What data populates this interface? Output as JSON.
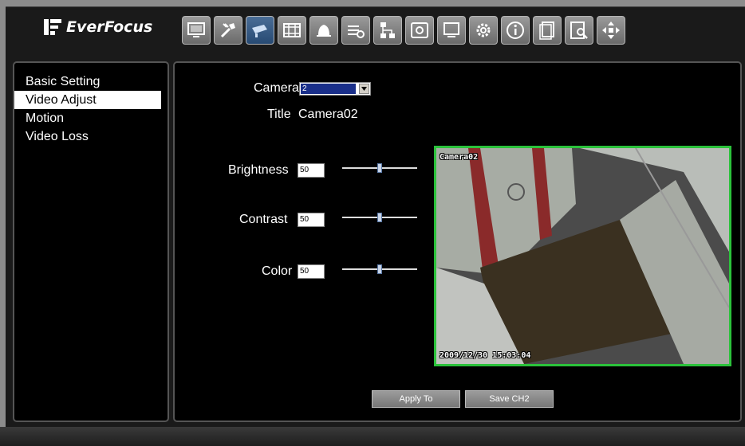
{
  "brand": {
    "name": "EverFocus",
    "logo_icon": "ef-logo-icon"
  },
  "toolbar": {
    "buttons": [
      {
        "icon": "monitor-icon"
      },
      {
        "icon": "tools-icon"
      },
      {
        "icon": "camera-icon",
        "active": true
      },
      {
        "icon": "film-icon"
      },
      {
        "icon": "alarm-bell-icon"
      },
      {
        "icon": "schedule-icon"
      },
      {
        "icon": "network-icon"
      },
      {
        "icon": "backup-disk-icon"
      },
      {
        "icon": "display-icon"
      },
      {
        "icon": "gear-icon"
      },
      {
        "icon": "info-icon"
      },
      {
        "icon": "log-icon"
      },
      {
        "icon": "search-icon"
      },
      {
        "icon": "ptz-icon"
      }
    ]
  },
  "sidebar": {
    "items": [
      {
        "label": "Basic Setting"
      },
      {
        "label": "Video Adjust",
        "selected": true
      },
      {
        "label": "Motion"
      },
      {
        "label": "Video Loss"
      }
    ]
  },
  "form": {
    "camera_label": "Camera",
    "camera_value": "2",
    "title_label": "Title",
    "title_value": "Camera02",
    "brightness_label": "Brightness",
    "brightness_value": "50",
    "contrast_label": "Contrast",
    "contrast_value": "50",
    "color_label": "Color",
    "color_value": "50",
    "slider_level_percent": 50
  },
  "preview": {
    "camera_name": "Camera02",
    "timestamp": "2009/12/30  15:03:04",
    "border_color": "#2bc23b"
  },
  "buttons": {
    "apply_label": "Apply To",
    "save_label": "Save CH2"
  },
  "colors": {
    "active_tab": "#3b5f8a",
    "selection": "#1a2f8a"
  }
}
